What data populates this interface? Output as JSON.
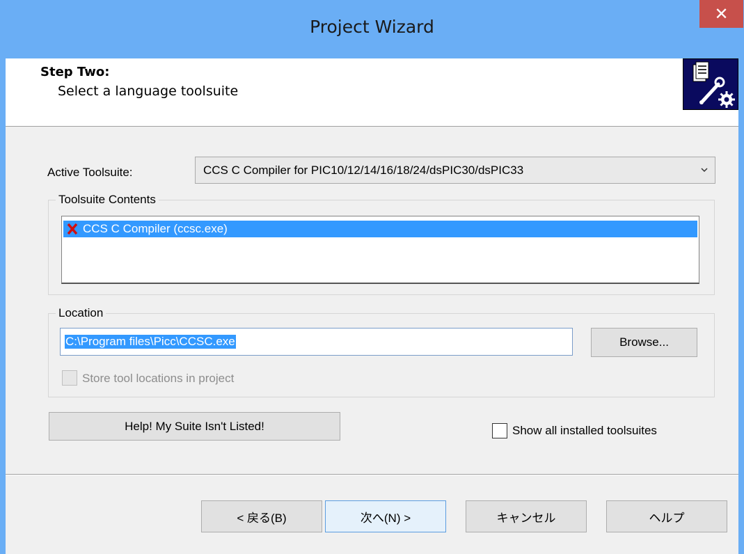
{
  "window": {
    "title": "Project Wizard",
    "close_glyph": "✕"
  },
  "header": {
    "step_title": "Step Two:",
    "step_subtitle": "Select a language toolsuite",
    "icon": "wizard-tools-icon"
  },
  "active_toolsuite": {
    "label": "Active Toolsuite:",
    "selected_value": "CCS C Compiler for PIC10/12/14/16/18/24/dsPIC30/dsPIC33"
  },
  "toolsuite_contents": {
    "legend": "Toolsuite Contents",
    "items": [
      {
        "label": "CCS C Compiler (ccsc.exe)",
        "status_icon": "red-x-icon",
        "selected": true
      }
    ]
  },
  "location": {
    "legend": "Location",
    "value": "C:\\Program files\\Picc\\CCSC.exe",
    "browse_label": "Browse...",
    "store_checkbox_label": "Store tool locations in project",
    "store_checkbox_checked": false,
    "store_checkbox_enabled": false
  },
  "help_suite_button": "Help!  My Suite Isn't Listed!",
  "show_all": {
    "label": "Show all installed toolsuites",
    "checked": false
  },
  "footer": {
    "back_label": "< 戻る(B)",
    "next_label": "次へ(N) >",
    "cancel_label": "キャンセル",
    "help_label": "ヘルプ"
  },
  "colors": {
    "titlebar": "#6aaef5",
    "close_button": "#c7504b",
    "selection": "#3399ff",
    "icon_background": "#0a0a5e"
  }
}
